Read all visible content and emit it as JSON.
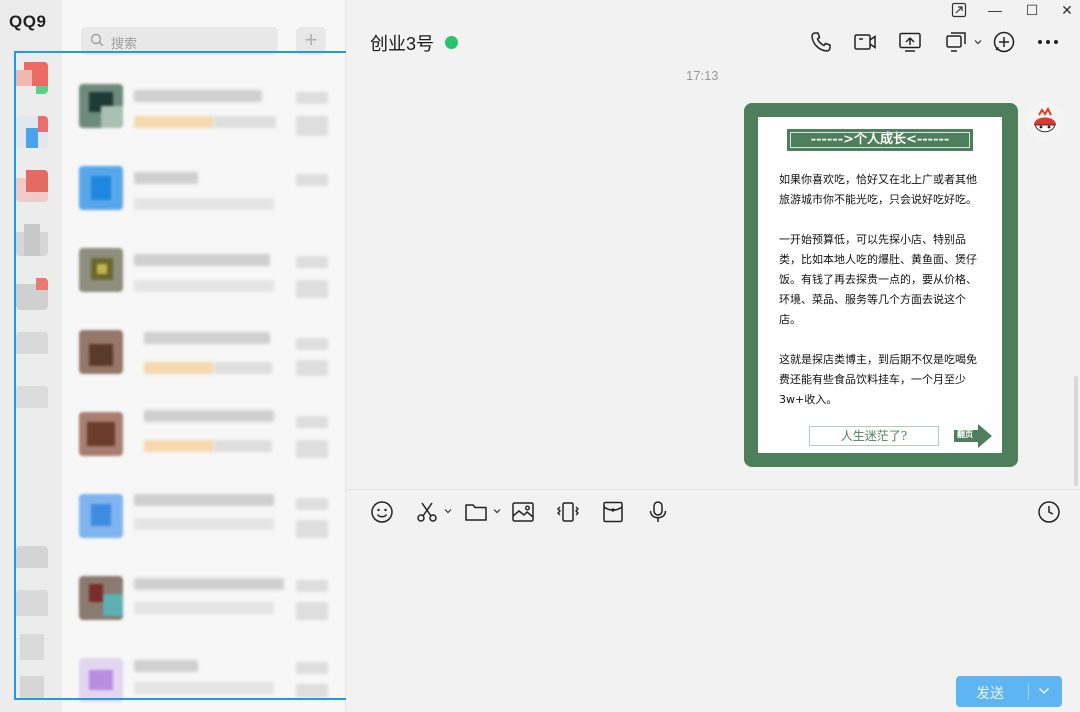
{
  "app": {
    "logo": "QQ9"
  },
  "search": {
    "placeholder": "搜索"
  },
  "list": {
    "add_label": "+"
  },
  "window_controls": {
    "pin": "⇱",
    "minimize": "—",
    "maximize": "☐",
    "close": "✕"
  },
  "chat": {
    "title": "创业3号",
    "status_color": "#27c46b",
    "timestamp": "17:13",
    "header_icons": [
      "phone-icon",
      "video-call-icon",
      "screen-share-icon",
      "remote-assist-icon",
      "add-member-icon",
      "more-icon"
    ],
    "message_card": {
      "title": "------>个人成长<------",
      "paragraphs": [
        "如果你喜欢吃，恰好又在北上广或者其他旅游城市你不能光吃，只会说好吃好吃。",
        "一开始预算低，可以先探小店、特别品类，比如本地人吃的爆肚、黄鱼面、煲仔饭。有钱了再去探贵一点的，要从价格、环境、菜品、服务等几个方面去说这个店。",
        "这就是探店类博主，到后期不仅是吃喝免费还能有些食品饮料挂车，一个月至少3w+收入。"
      ],
      "footer": "人生迷茫了?",
      "next_label": "翻页",
      "accent_color": "#4e7f5d"
    }
  },
  "toolbar": {
    "icons": [
      "emoji-icon",
      "scissors-icon",
      "folder-icon",
      "image-icon",
      "shake-icon",
      "red-packet-icon",
      "microphone-icon",
      "history-icon"
    ]
  },
  "send": {
    "label": "发送",
    "color": "#5fb4f2"
  }
}
